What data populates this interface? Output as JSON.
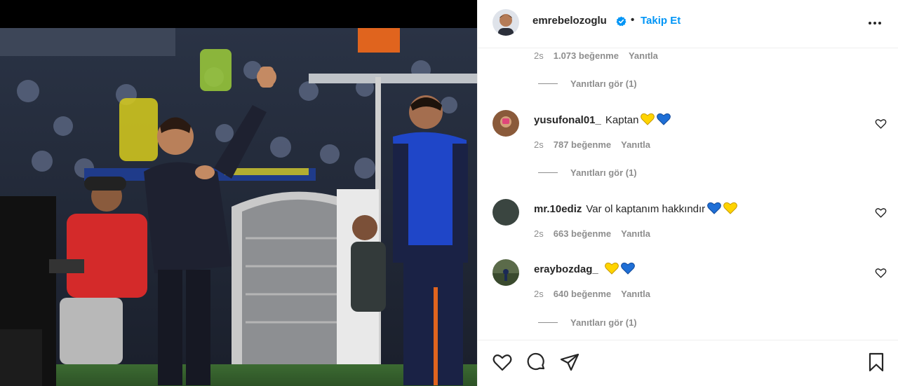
{
  "post": {
    "author": "emrebelozoglu",
    "separator": "•",
    "follow_label": "Takip Et",
    "more_icon": "more-horizontal-icon",
    "verified_icon": "verified-badge-icon",
    "colors": {
      "accent": "#0095f6",
      "muted": "#8e8e8e",
      "text": "#262626",
      "heart_yellow": "#ffd400",
      "heart_blue": "#1f6fd6"
    }
  },
  "comments": [
    {
      "time": "2s",
      "likes": "1.073 beğenme",
      "reply_label": "Yanıtla",
      "view_replies": "Yanıtları gör (1)"
    },
    {
      "user": "yusufonal01_",
      "text": "Kaptan",
      "emojis": [
        "yellow-heart",
        "blue-heart"
      ],
      "time": "2s",
      "likes": "787 beğenme",
      "reply_label": "Yanıtla",
      "view_replies": "Yanıtları gör (1)"
    },
    {
      "user": "mr.10ediz",
      "text": "Var ol kaptanım hakkındır",
      "emojis": [
        "blue-heart",
        "yellow-heart"
      ],
      "time": "2s",
      "likes": "663 beğenme",
      "reply_label": "Yanıtla"
    },
    {
      "user": "eraybozdag_",
      "text": "",
      "emojis": [
        "yellow-heart",
        "blue-heart"
      ],
      "time": "2s",
      "likes": "640 beğenme",
      "reply_label": "Yanıtla",
      "view_replies": "Yanıtları gör (1)"
    }
  ],
  "actions": {
    "like_icon": "heart-icon",
    "comment_icon": "comment-icon",
    "share_icon": "send-icon",
    "save_icon": "bookmark-icon"
  }
}
